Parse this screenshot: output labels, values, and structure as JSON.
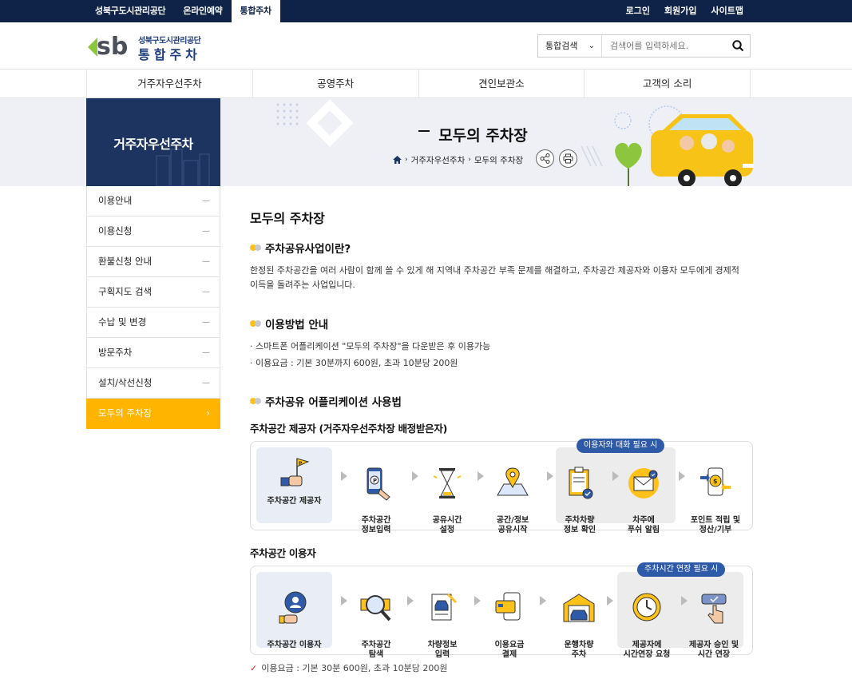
{
  "topbar": {
    "left": [
      "성북구도시관리공단",
      "온라인예약",
      "통합주차"
    ],
    "right": [
      "로그인",
      "회원가입",
      "사이트맵"
    ]
  },
  "logo": {
    "org": "성북구도시관리공단",
    "name": "통합주차",
    "mark": "sb"
  },
  "search": {
    "select": "통합검색",
    "placeholder": "검색어를 입력하세요."
  },
  "gnb": [
    "거주자우선주차",
    "공영주차",
    "견인보관소",
    "고객의 소리"
  ],
  "side": {
    "title": "거주자우선주차",
    "items": [
      "이용안내",
      "이용신청",
      "환불신청 안내",
      "구획지도 검색",
      "수납 및 변경",
      "방문주차",
      "설치/삭선신청",
      "모두의 주차장"
    ]
  },
  "hero": {
    "title": "모두의 주차장",
    "breadcrumb": [
      "거주자우선주차",
      "모두의 주차장"
    ]
  },
  "page": {
    "title": "모두의 주차장",
    "sec1": {
      "heading": "주차공유사업이란?",
      "body": "한정된 주차공간을 여러 사람이 함께 쓸 수 있게 해 지역내 주차공간 부족 문제를 해결하고, 주차공간 제공자와 이용자 모두에게 경제적 이득을 돌려주는 사업입니다."
    },
    "sec2": {
      "heading": "이용방법 안내",
      "bullets": [
        "스마트폰 어플리케이션 \"모두의 주차장\"을 다운받은 후 이용가능",
        "이용요금 : 기본 30분까지 600원, 초과 10분당 200원"
      ]
    },
    "sec3": {
      "heading": "주차공유 어플리케이션 사용법",
      "provider": {
        "title": "주차공간 제공자 (거주자우선주차장 배정받은자)",
        "pill": "이용자와 대화 필요 시",
        "steps": [
          "주차공간 제공자",
          "주차공간\n정보입력",
          "공유시간\n설정",
          "공간/정보\n공유시작",
          "주차차량\n정보 확인",
          "차주에\n푸쉬 알림",
          "포인트 적립 및\n정산/기부"
        ]
      },
      "user": {
        "title": "주차공간 이용자",
        "pill": "주차시간 연장 필요 시",
        "steps": [
          "주차공간 이용자",
          "주차공간\n탐색",
          "차량정보\n입력",
          "이용요금\n결제",
          "운행차량\n주차",
          "제공자에\n시간연장 요청",
          "제공자 승인 및\n시간 연장"
        ]
      },
      "note": "이용요금 : 기본 30분 600원, 초과 10분당 200원"
    }
  },
  "colors": {
    "navy": "#0f2348",
    "accent": "#ffb400",
    "sidenavy": "#1d3461",
    "pill": "#2e5aa8"
  }
}
